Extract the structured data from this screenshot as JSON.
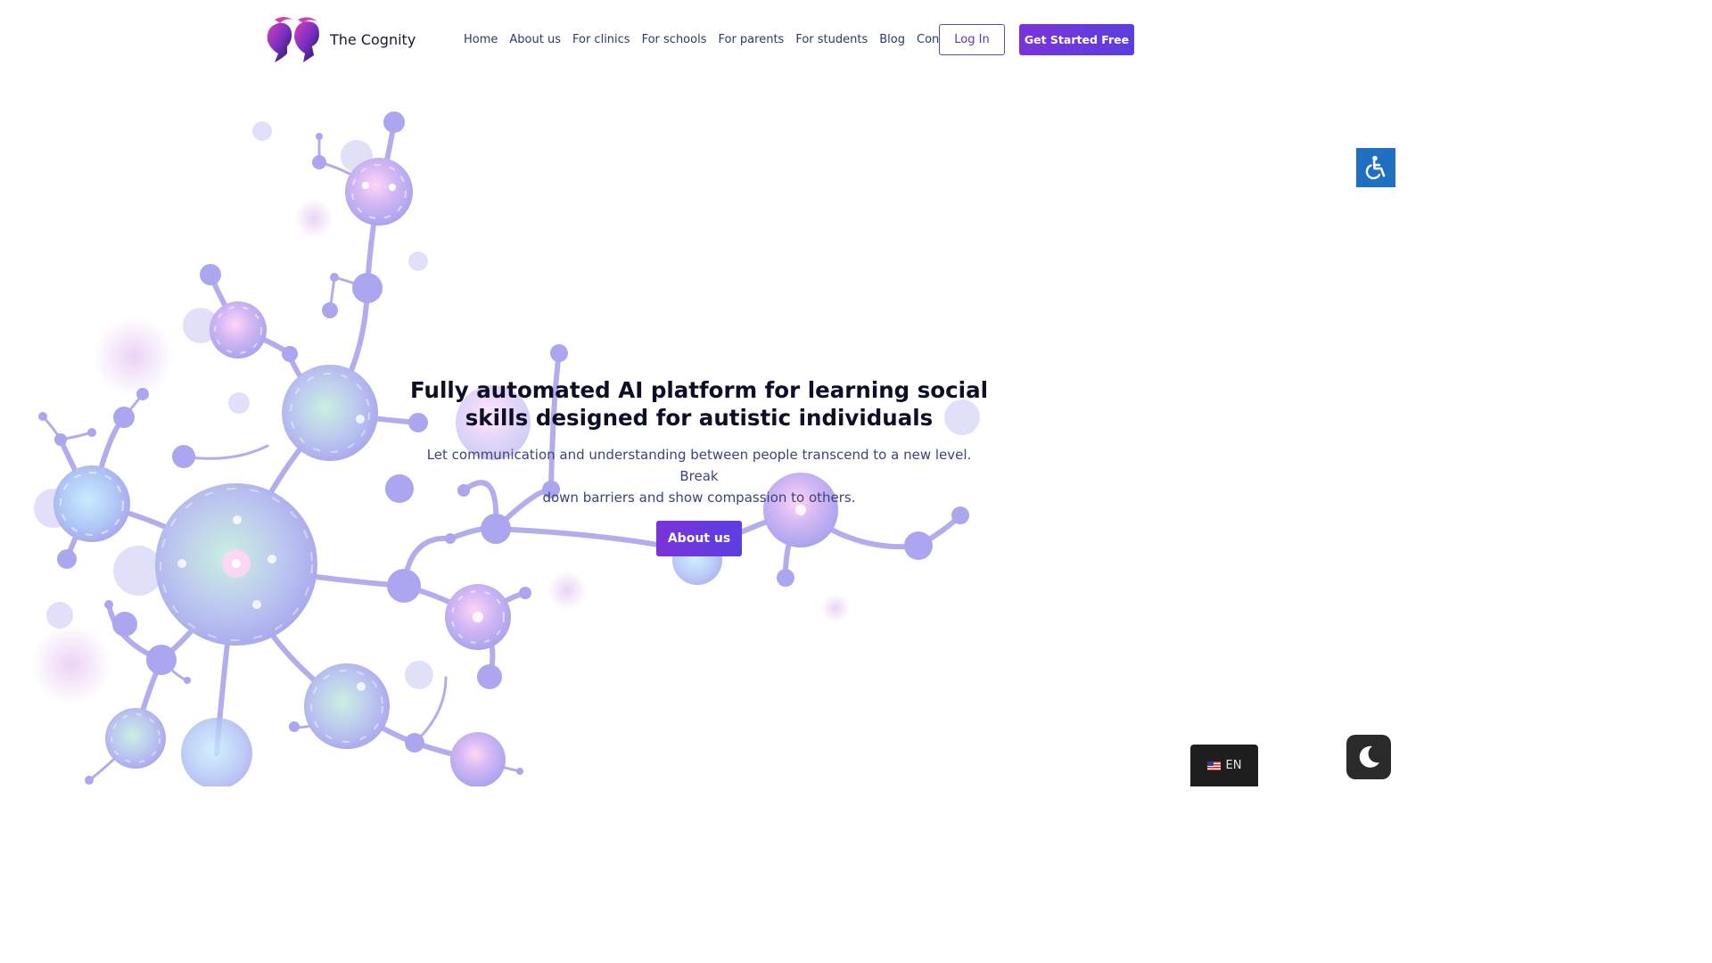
{
  "brand": {
    "name": "The Cognity"
  },
  "nav": {
    "items": [
      {
        "label": "Home"
      },
      {
        "label": "About us"
      },
      {
        "label": "For clinics"
      },
      {
        "label": "For schools"
      },
      {
        "label": "For parents"
      },
      {
        "label": "For students"
      },
      {
        "label": "Blog"
      },
      {
        "label": "Contact"
      }
    ],
    "login_label": "Log In",
    "start_label": "Get Started Free"
  },
  "hero": {
    "title_line1": "Fully automated AI platform for learning social",
    "title_line2": "skills designed for autistic individuals",
    "subtitle_line1": "Let communication and understanding between people transcend to a new level. Break",
    "subtitle_line2": "down barriers and show compassion to others.",
    "cta_label": "About us"
  },
  "widgets": {
    "language_label": "EN",
    "accessibility_icon": "wheelchair-icon",
    "darkmode_icon": "moon-icon"
  },
  "colors": {
    "accent": "#6a3fd4",
    "accent_gradient_start": "#7a33d9",
    "accent_gradient_end": "#5b3fe0",
    "heading": "#0c0f26",
    "body_text": "#3c4478",
    "nav_text": "#2d3a66",
    "network": "#b3adee",
    "accessibility_bg": "#1f6fc2"
  }
}
